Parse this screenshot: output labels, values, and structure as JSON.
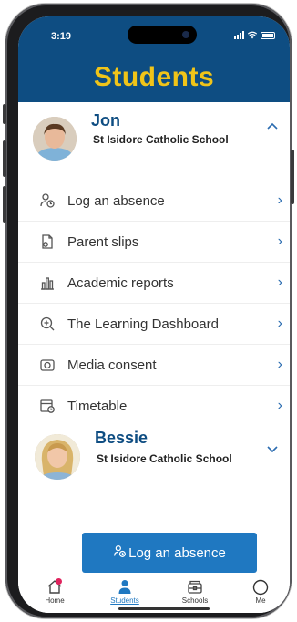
{
  "status_bar": {
    "time": "3:19"
  },
  "header": {
    "title": "Students"
  },
  "students": [
    {
      "name": "Jon",
      "school": "St Isidore Catholic School",
      "expanded": true
    },
    {
      "name": "Bessie",
      "school": "St Isidore Catholic School",
      "expanded": false
    }
  ],
  "menu": {
    "items": [
      {
        "label": "Log an absence",
        "icon": "person-clock-icon"
      },
      {
        "label": "Parent slips",
        "icon": "document-icon"
      },
      {
        "label": "Academic reports",
        "icon": "bar-chart-icon"
      },
      {
        "label": "The Learning Dashboard",
        "icon": "magnifier-icon"
      },
      {
        "label": "Media consent",
        "icon": "camera-icon"
      },
      {
        "label": "Timetable",
        "icon": "calendar-clock-icon"
      }
    ]
  },
  "primary_action": {
    "label": "Log an absence",
    "icon": "person-clock-icon"
  },
  "tabbar": {
    "items": [
      {
        "label": "Home",
        "icon": "home-icon"
      },
      {
        "label": "Students",
        "icon": "person-icon",
        "active": true
      },
      {
        "label": "Schools",
        "icon": "school-icon"
      },
      {
        "label": "Me",
        "icon": "profile-circle-icon"
      }
    ]
  },
  "colors": {
    "header_bg": "#0e4d82",
    "title": "#f0c419",
    "accent": "#1f78c1",
    "name": "#0e4d82",
    "badge": "#e0245e"
  }
}
